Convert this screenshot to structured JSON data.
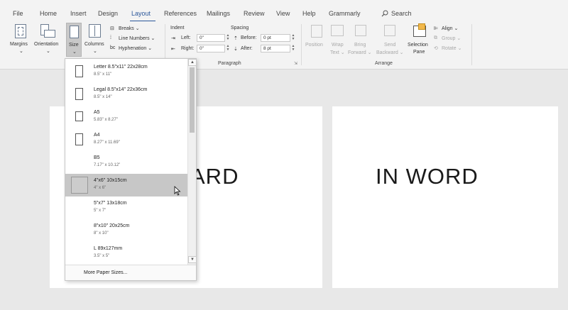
{
  "menu": {
    "tabs": [
      "File",
      "Home",
      "Insert",
      "Design",
      "Layout",
      "References",
      "Mailings",
      "Review",
      "View",
      "Help",
      "Grammarly"
    ],
    "active_tab": "Layout",
    "search_label": "Search"
  },
  "ribbon": {
    "margins": "Margins",
    "orientation": "Orientation",
    "size": "Size",
    "columns": "Columns",
    "breaks": "Breaks ⌄",
    "line_numbers": "Line Numbers ⌄",
    "hyphenation": "Hyphenation ⌄",
    "indent_title": "Indent",
    "spacing_title": "Spacing",
    "left_label": "Left:",
    "left_value": "0\"",
    "right_label": "Right:",
    "right_value": "0\"",
    "before_label": "Before:",
    "before_value": "0 pt",
    "after_label": "After:",
    "after_value": "8 pt",
    "paragraph_group": "Paragraph",
    "position": "Position",
    "wrap_text_1": "Wrap",
    "wrap_text_2": "Text ⌄",
    "bring_forward_1": "Bring",
    "bring_forward_2": "Forward ⌄",
    "send_backward_1": "Send",
    "send_backward_2": "Backward ⌄",
    "selection_pane_1": "Selection",
    "selection_pane_2": "Pane",
    "align": "Align ⌄",
    "group": "Group ⌄",
    "rotate": "Rotate ⌄",
    "arrange_group": "Arrange"
  },
  "page_sizes": [
    {
      "name": "Letter 8.5\"x11\" 22x28cm",
      "dims": "8.5\" x 11\""
    },
    {
      "name": "Legal 8.5\"x14\" 22x36cm",
      "dims": "8.5\" x 14\""
    },
    {
      "name": "A5",
      "dims": "5.83\" x 8.27\""
    },
    {
      "name": "A4",
      "dims": "8.27\" x 11.69\""
    },
    {
      "name": "B5",
      "dims": "7.17\" x 10.12\""
    },
    {
      "name": "4\"x6\" 10x15cm",
      "dims": "4\" x 6\""
    },
    {
      "name": "5\"x7\" 13x18cm",
      "dims": "5\" x 7\""
    },
    {
      "name": "8\"x10\" 20x25cm",
      "dims": "8\" x 10\""
    },
    {
      "name": "L 89x127mm",
      "dims": "3.5\" x 5\""
    }
  ],
  "selected_size": "4\"x6\" 10x15cm",
  "more_paper_sizes": "More Paper Sizes...",
  "document": {
    "left_page_text": "ARD",
    "right_page_text": "IN WORD"
  },
  "colors": {
    "accent": "#2b579a",
    "ribbon_bg": "#f3f3f3",
    "canvas_bg": "#e8e8e8",
    "selected_item": "#c7c7c7"
  }
}
